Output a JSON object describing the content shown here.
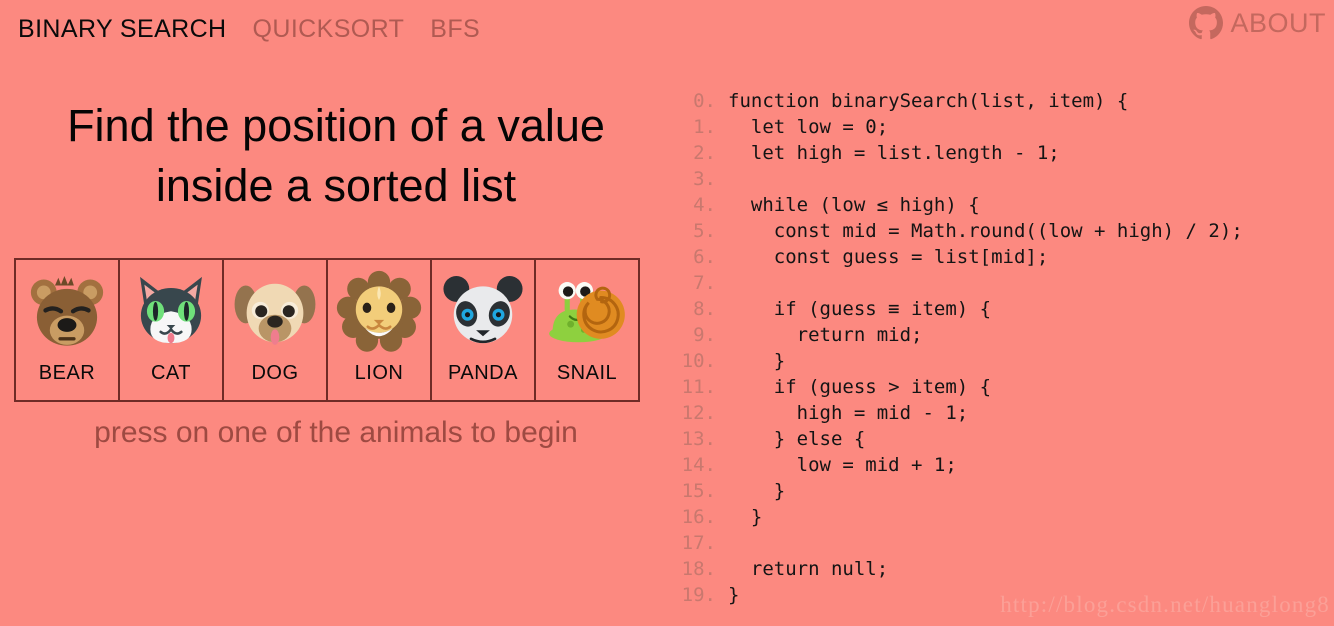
{
  "header": {
    "nav": [
      {
        "label": "BINARY SEARCH",
        "active": true
      },
      {
        "label": "QUICKSORT",
        "active": false
      },
      {
        "label": "BFS",
        "active": false
      }
    ],
    "about_label": "ABOUT",
    "github_icon": "github-icon"
  },
  "main": {
    "headline_line1": "Find the position of a value",
    "headline_line2": "inside a sorted list",
    "hint": "press on one of the animals to begin",
    "cards": [
      {
        "label": "BEAR",
        "icon": "bear-face-icon"
      },
      {
        "label": "CAT",
        "icon": "cat-face-icon"
      },
      {
        "label": "DOG",
        "icon": "dog-face-icon"
      },
      {
        "label": "LION",
        "icon": "lion-face-icon"
      },
      {
        "label": "PANDA",
        "icon": "panda-face-icon"
      },
      {
        "label": "SNAIL",
        "icon": "snail-icon"
      }
    ]
  },
  "code": {
    "lines": [
      {
        "n": "0.",
        "text": "function binarySearch(list, item) {"
      },
      {
        "n": "1.",
        "text": "  let low = 0;"
      },
      {
        "n": "2.",
        "text": "  let high = list.length - 1;"
      },
      {
        "n": "3.",
        "text": ""
      },
      {
        "n": "4.",
        "text": "  while (low ≤ high) {"
      },
      {
        "n": "5.",
        "text": "    const mid = Math.round((low + high) / 2);"
      },
      {
        "n": "6.",
        "text": "    const guess = list[mid];"
      },
      {
        "n": "7.",
        "text": ""
      },
      {
        "n": "8.",
        "text": "    if (guess ≡ item) {"
      },
      {
        "n": "9.",
        "text": "      return mid;"
      },
      {
        "n": "10.",
        "text": "    }"
      },
      {
        "n": "11.",
        "text": "    if (guess > item) {"
      },
      {
        "n": "12.",
        "text": "      high = mid - 1;"
      },
      {
        "n": "13.",
        "text": "    } else {"
      },
      {
        "n": "14.",
        "text": "      low = mid + 1;"
      },
      {
        "n": "15.",
        "text": "    }"
      },
      {
        "n": "16.",
        "text": "  }"
      },
      {
        "n": "17.",
        "text": ""
      },
      {
        "n": "18.",
        "text": "  return null;"
      },
      {
        "n": "19.",
        "text": "}"
      }
    ]
  },
  "watermark": "http://blog.csdn.net/huanglong8",
  "colors": {
    "background": "#fc8980",
    "nav_active": "#0a0a0a",
    "nav_inactive": "#b05a52",
    "about": "#c4685e",
    "headline": "#050505",
    "hint": "#9e4a42",
    "card_border": "#6e2b26",
    "line_number": "#c9786e",
    "code_text": "#141414",
    "watermark": "#fba097"
  }
}
